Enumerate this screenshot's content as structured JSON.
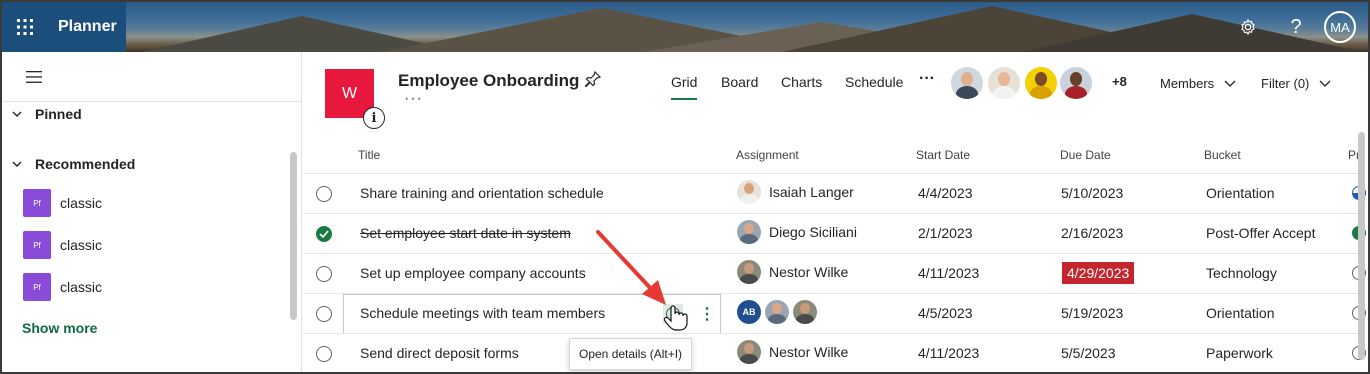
{
  "app": {
    "name": "Planner",
    "user_initials": "MA"
  },
  "sidebar": {
    "sections": [
      {
        "label": "Pinned"
      },
      {
        "label": "Recommended"
      }
    ],
    "items": [
      {
        "icon_text": "Pf",
        "label": "classic"
      },
      {
        "icon_text": "Pf",
        "label": "classic"
      },
      {
        "icon_text": "Pf",
        "label": "classic"
      }
    ],
    "show_more": "Show more"
  },
  "plan": {
    "logo_letter": "W",
    "title": "Employee Onboarding",
    "more": "···",
    "tabs": [
      "Grid",
      "Board",
      "Charts",
      "Schedule"
    ],
    "active_tab": "Grid",
    "tabs_more": "···",
    "members_extra": "+8",
    "members_label": "Members",
    "filter_label": "Filter (0)"
  },
  "grid": {
    "columns": [
      "Title",
      "Assignment",
      "Start Date",
      "Due Date",
      "Bucket",
      "Pr"
    ],
    "rows": [
      {
        "title": "Share training and orientation schedule",
        "assignee": "Isaiah Langer",
        "start": "4/4/2023",
        "due": "5/10/2023",
        "bucket": "Orientation",
        "completed": false,
        "progress": "in-progress"
      },
      {
        "title": "Set employee start date in system",
        "assignee": "Diego Siciliani",
        "start": "2/1/2023",
        "due": "2/16/2023",
        "bucket": "Post-Offer Accept",
        "completed": true,
        "progress": "completed"
      },
      {
        "title": "Set up employee company accounts",
        "assignee": "Nestor Wilke",
        "start": "4/11/2023",
        "due": "4/29/2023",
        "bucket": "Technology",
        "completed": false,
        "progress": "not-started",
        "overdue": true
      },
      {
        "title": "Schedule meetings with team members",
        "assignee_initials": "AB",
        "start": "4/5/2023",
        "due": "5/19/2023",
        "bucket": "Orientation",
        "completed": false,
        "progress": "not-started"
      },
      {
        "title": "Send direct deposit forms",
        "assignee": "Nestor Wilke",
        "start": "4/11/2023",
        "due": "5/5/2023",
        "bucket": "Paperwork",
        "completed": false,
        "progress": "not-started"
      }
    ]
  },
  "tooltip": "Open details (Alt+I)",
  "colors": {
    "accent": "#1a7a45",
    "overdue": "#c4262e",
    "plan_logo": "#e8173d",
    "suite_bar": "#1c4e7c",
    "arrow": "#e53935"
  }
}
